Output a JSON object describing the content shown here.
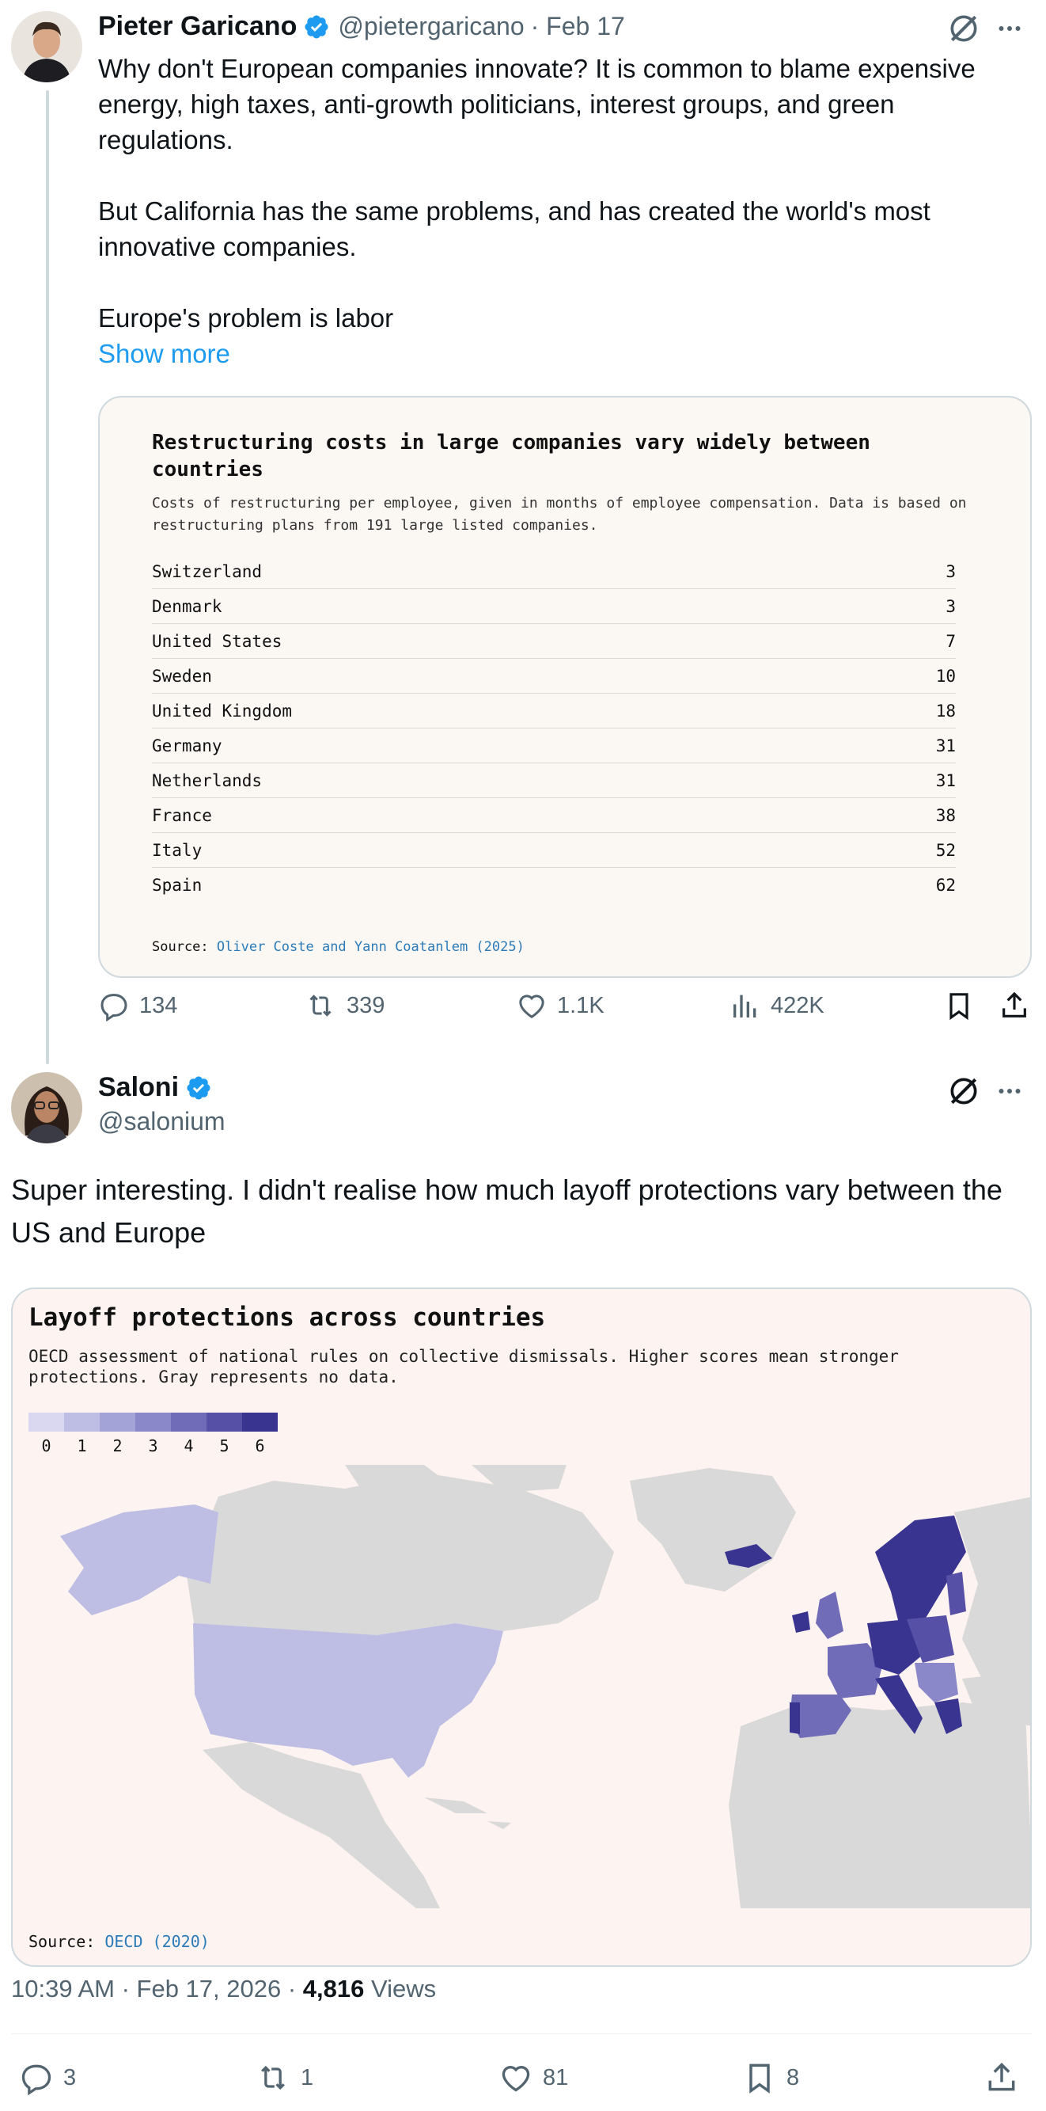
{
  "tweet1": {
    "name": "Pieter Garicano",
    "handle": "@pietergaricano",
    "date": "· Feb 17",
    "text": "Why don't European companies innovate? It is common to blame expensive energy, high taxes, anti-growth politicians, interest groups, and green regulations.\n\nBut California has the same problems, and has created the world's most innovative companies.\n\nEurope's problem is labor",
    "show_more": "Show more",
    "card": {
      "title": "Restructuring costs in large companies vary widely between countries",
      "subtitle": "Costs of restructuring per employee, given in months of employee compensation. Data is based on restructuring plans from 191 large listed companies.",
      "rows": [
        {
          "country": "Switzerland",
          "value": "3"
        },
        {
          "country": "Denmark",
          "value": "3"
        },
        {
          "country": "United States",
          "value": "7"
        },
        {
          "country": "Sweden",
          "value": "10"
        },
        {
          "country": "United Kingdom",
          "value": "18"
        },
        {
          "country": "Germany",
          "value": "31"
        },
        {
          "country": "Netherlands",
          "value": "31"
        },
        {
          "country": "France",
          "value": "38"
        },
        {
          "country": "Italy",
          "value": "52"
        },
        {
          "country": "Spain",
          "value": "62"
        }
      ],
      "source_label": "Source:",
      "source_link": "Oliver Coste and Yann Coatanlem (2025)"
    },
    "actions": {
      "replies": "134",
      "reposts": "339",
      "likes": "1.1K",
      "views": "422K"
    }
  },
  "tweet2": {
    "name": "Saloni",
    "handle": "@salonium",
    "text": "Super interesting. I didn't realise how much layoff protections vary between the US and Europe",
    "card": {
      "title": "Layoff protections across countries",
      "subtitle": "OECD assessment of national rules on collective dismissals. Higher scores mean stronger protections. Gray represents no data.",
      "legend": [
        {
          "label": "0",
          "color": "#d9d8f0"
        },
        {
          "label": "1",
          "color": "#bebee5"
        },
        {
          "label": "2",
          "color": "#a4a3d8"
        },
        {
          "label": "3",
          "color": "#8a88c9"
        },
        {
          "label": "4",
          "color": "#706cb8"
        },
        {
          "label": "5",
          "color": "#5650a6"
        },
        {
          "label": "6",
          "color": "#3a3491"
        }
      ],
      "source_label": "Source:",
      "source_link": "OECD (2020)"
    },
    "meta_time": "10:39 AM · Feb 17, 2026 · ",
    "meta_views_count": "4,816",
    "meta_views_label": " Views",
    "actions": {
      "replies": "3",
      "reposts": "1",
      "likes": "81",
      "bookmarks": "8"
    }
  },
  "colors": {
    "accent": "#1d9bf0",
    "verified": "#1d9bf0",
    "land_gray": "#d9d9d9",
    "us_fill": "#bebee5"
  }
}
